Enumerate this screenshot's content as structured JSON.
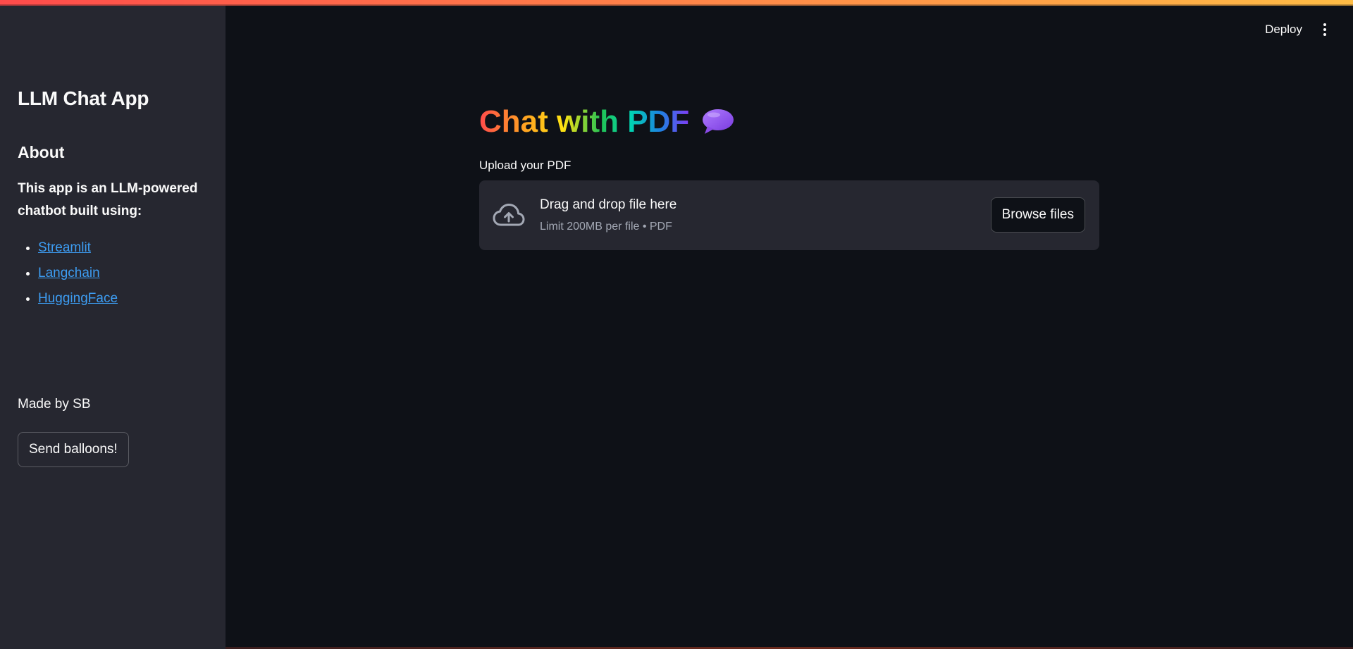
{
  "sidebar": {
    "title": "LLM Chat App",
    "about_heading": "About",
    "description": "This app is an LLM-powered chatbot built using:",
    "links": [
      {
        "label": "Streamlit"
      },
      {
        "label": "Langchain"
      },
      {
        "label": "HuggingFace"
      }
    ],
    "made_by": "Made by SB",
    "balloon_button": "Send balloons!"
  },
  "header": {
    "deploy_label": "Deploy",
    "menu_icon": "vertical-ellipsis-icon"
  },
  "main": {
    "title": "Chat with PDF",
    "title_icon": "speech-bubble-icon",
    "upload_label": "Upload your PDF",
    "dropzone": {
      "icon": "cloud-upload-icon",
      "title": "Drag and drop file here",
      "subtitle": "Limit 200MB per file • PDF",
      "browse_label": "Browse files"
    }
  },
  "colors": {
    "background": "#0e1117",
    "sidebar": "#262730",
    "link": "#3d9df3",
    "accent_gradient_start": "#ff4b4b",
    "accent_gradient_end": "#ffbd45"
  }
}
